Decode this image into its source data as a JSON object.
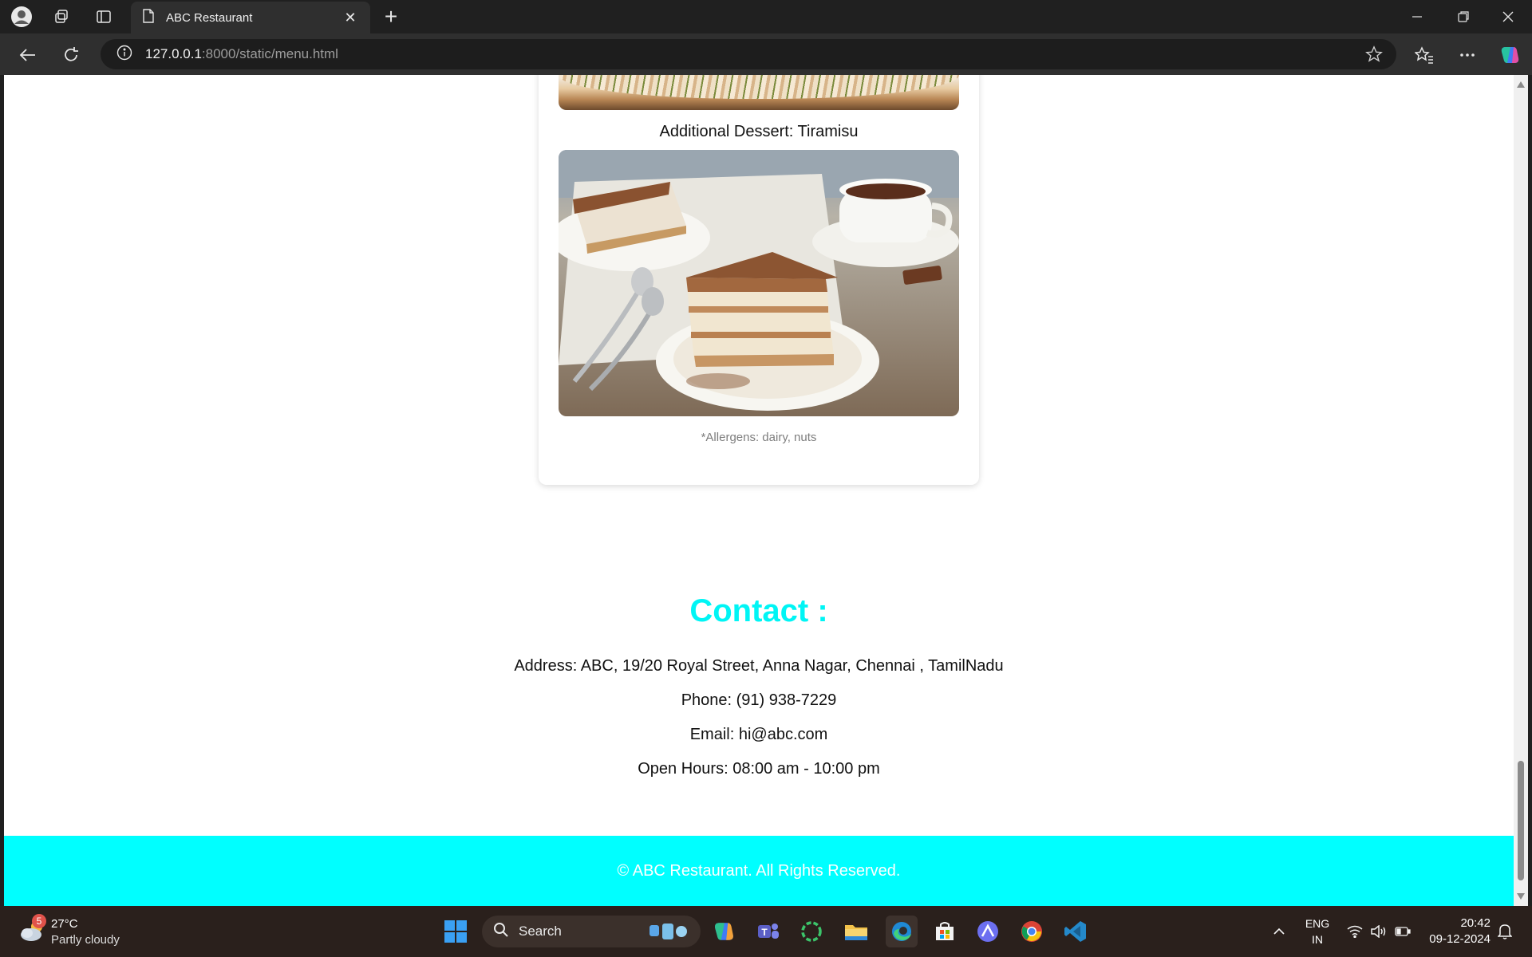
{
  "browser": {
    "tab_title": "ABC Restaurant",
    "url_host": "127.0.0.1",
    "url_rest": ":8000/static/menu.html"
  },
  "page": {
    "dish_caption": "Additional Dessert: Tiramisu",
    "dish_image_alt": "Tiramisu",
    "allergens": "*Allergens: dairy, nuts",
    "contact": {
      "title": "Contact :",
      "address": "Address: ABC, 19/20 Royal Street, Anna Nagar, Chennai , TamilNadu",
      "phone": "Phone: (91) 938-7229",
      "email": "Email: hi@abc.com",
      "hours": "Open Hours: 08:00 am - 10:00 pm"
    },
    "footer": "© ABC Restaurant. All Rights Reserved.",
    "accent_color": "#00ffff"
  },
  "taskbar": {
    "weather_badge": "5",
    "temperature": "27°C",
    "condition": "Partly cloudy",
    "search_label": "Search",
    "lang_line1": "ENG",
    "lang_line2": "IN",
    "time": "20:42",
    "date": "09-12-2024"
  }
}
